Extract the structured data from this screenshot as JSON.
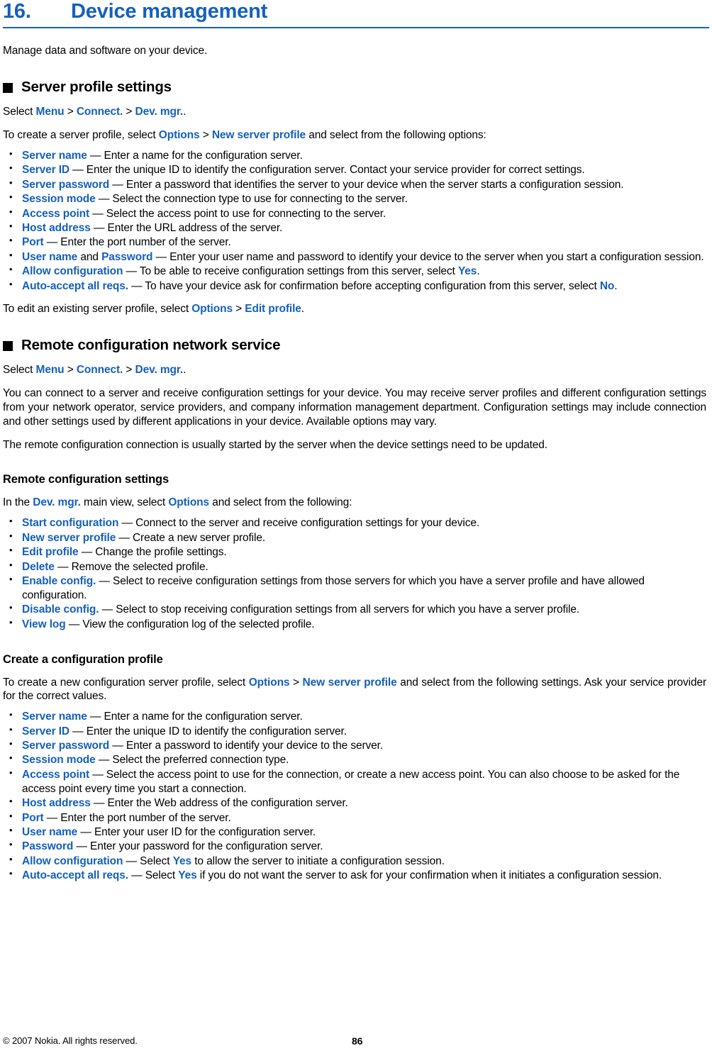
{
  "chapter": {
    "number": "16.",
    "title": "Device management",
    "accent_color": "#1560bd"
  },
  "intro": "Manage data and software on your device.",
  "sections": [
    {
      "heading": "Server profile settings",
      "select_path": {
        "lead": "Select ",
        "items": [
          "Menu",
          "Connect.",
          "Dev. mgr."
        ],
        "trail": "."
      },
      "lead_in": {
        "before": "To create a server profile, select ",
        "ui1": "Options",
        "mid": " > ",
        "ui2": "New server profile",
        "after": " and select from the following options:"
      },
      "bullets": [
        {
          "term": "Server name",
          "desc": " — Enter a name for the configuration server."
        },
        {
          "term": "Server ID",
          "desc": " — Enter the unique ID to identify the configuration server. Contact your service provider for correct settings."
        },
        {
          "term": "Server password",
          "desc": " — Enter a password that identifies the server to your device when the server starts a configuration session."
        },
        {
          "term": "Session mode",
          "desc": " — Select the connection type to use for connecting to the server."
        },
        {
          "term": "Access point",
          "desc": " — Select the access point to use for connecting to the server."
        },
        {
          "term": "Host address",
          "desc": " — Enter the URL address of the server."
        },
        {
          "term": "Port",
          "desc": " — Enter the port number of the server."
        },
        {
          "term": "User name",
          "conj": " and ",
          "term2": "Password",
          "desc": " — Enter your user name and password to identify your device to the server when you start a configuration session."
        },
        {
          "term": "Allow configuration",
          "desc": " — To be able to receive configuration settings from this server, select ",
          "tail_ui": "Yes",
          "tail": "."
        },
        {
          "term": "Auto-accept all reqs.",
          "desc": " — To have your device ask for confirmation before accepting configuration from this server, select ",
          "tail_ui": "No",
          "tail": "."
        }
      ],
      "closing": {
        "before": "To edit an existing server profile, select ",
        "ui1": "Options",
        "mid": " > ",
        "ui2": "Edit profile",
        "after": "."
      }
    },
    {
      "heading": "Remote configuration network service",
      "select_path": {
        "lead": "Select ",
        "items": [
          "Menu",
          "Connect.",
          "Dev. mgr."
        ],
        "trail": "."
      },
      "paragraphs": [
        "You can connect to a server and receive configuration settings for your device. You may receive server profiles and different configuration settings from your network operator, service providers, and company information management department. Configuration settings may include connection and other settings used by different applications in your device. Available options may vary.",
        "The remote configuration connection is usually started by the server when the device settings need to be updated."
      ],
      "subsections": [
        {
          "heading": "Remote configuration settings",
          "lead_in": {
            "before": "In the ",
            "ui1": "Dev. mgr.",
            "mid": " main view, select ",
            "ui2": "Options",
            "after": " and select from the following:"
          },
          "bullets": [
            {
              "term": "Start configuration",
              "desc": " — Connect to the server and receive configuration settings for your device."
            },
            {
              "term": "New server profile",
              "desc": " — Create a new server profile."
            },
            {
              "term": "Edit profile",
              "desc": " — Change the profile settings."
            },
            {
              "term": "Delete",
              "desc": " — Remove the selected profile."
            },
            {
              "term": "Enable config.",
              "desc": " — Select to receive configuration settings from those servers for which you have a server profile and have allowed configuration."
            },
            {
              "term": "Disable config.",
              "desc": " — Select to stop receiving configuration settings from all servers for which you have a server profile."
            },
            {
              "term": "View log",
              "desc": " — View the configuration log of the selected profile."
            }
          ]
        },
        {
          "heading": "Create a configuration profile",
          "lead_in": {
            "before": "To create a new configuration server profile, select ",
            "ui1": "Options",
            "mid": " > ",
            "ui2": "New server profile",
            "after": " and select from the following settings. Ask your service provider for the correct values."
          },
          "bullets": [
            {
              "term": "Server name",
              "desc": " — Enter a name for the configuration server."
            },
            {
              "term": "Server ID",
              "desc": " — Enter the unique ID to identify the configuration server."
            },
            {
              "term": "Server password",
              "desc": " — Enter a password to identify your device to the server."
            },
            {
              "term": "Session mode",
              "desc": " — Select the preferred connection type."
            },
            {
              "term": "Access point",
              "desc": " — Select the access point to use for the connection, or create a new access point. You can also choose to be asked for the access point every time you start a connection."
            },
            {
              "term": "Host address",
              "desc": " — Enter the Web address of the configuration server."
            },
            {
              "term": "Port",
              "desc": " — Enter the port number of the server."
            },
            {
              "term": "User name",
              "desc": " — Enter your user ID for the configuration server."
            },
            {
              "term": "Password",
              "desc": " — Enter your password for the configuration server."
            },
            {
              "term": "Allow configuration",
              "desc": " — Select ",
              "tail_ui": "Yes",
              "tail": " to allow the server to initiate a configuration session."
            },
            {
              "term": "Auto-accept all reqs.",
              "desc": " — Select ",
              "tail_ui": "Yes",
              "tail": " if you do not want the server to ask for your confirmation when it initiates a configuration session."
            }
          ]
        }
      ]
    }
  ],
  "footer": {
    "copyright": "© 2007 Nokia. All rights reserved.",
    "page_number": "86"
  }
}
